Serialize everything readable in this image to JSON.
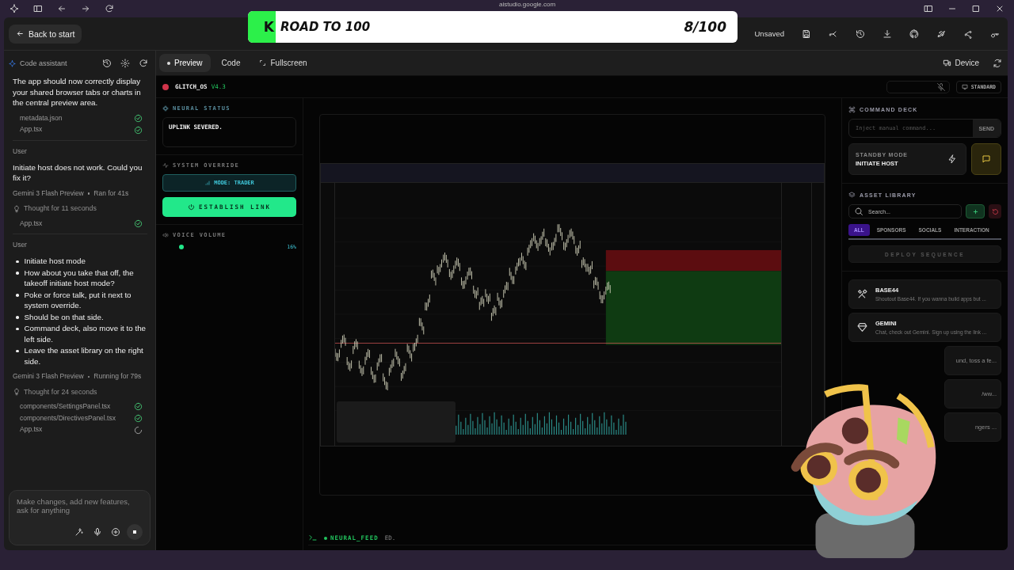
{
  "browser": {
    "url": "aistudio.google.com"
  },
  "banner": {
    "logo": "K",
    "title": "ROAD TO 100",
    "count": "8/100"
  },
  "header": {
    "back": "Back to start",
    "status": "Unsaved"
  },
  "assistant": {
    "title": "Code assistant",
    "blocks": [
      {
        "kind": "text",
        "text": "The app should now correctly display your shared browser tabs or charts in the central preview area."
      },
      {
        "kind": "files",
        "files": [
          {
            "name": "metadata.json",
            "done": true
          },
          {
            "name": "App.tsx",
            "done": true
          }
        ]
      },
      {
        "kind": "user",
        "label": "User",
        "text": "Initiate host does not work. Could you fix it?"
      },
      {
        "kind": "meta",
        "model": "Gemini 3 Flash Preview",
        "status": "Ran for 41s"
      },
      {
        "kind": "thought",
        "text": "Thought for 11 seconds"
      },
      {
        "kind": "files",
        "files": [
          {
            "name": "App.tsx",
            "done": true
          }
        ]
      },
      {
        "kind": "bullets",
        "label": "User",
        "items": [
          "Initiate host mode",
          "How about you take that off, the takeoff initiate host mode?",
          "Poke or force talk, put it next to system override.",
          "Should be on that side.",
          "Command deck, also move it to the left side.",
          "Leave the asset library on the right side."
        ]
      },
      {
        "kind": "meta",
        "model": "Gemini 3 Flash Preview",
        "status": "Running for 79s"
      },
      {
        "kind": "thought",
        "text": "Thought for 24 seconds"
      },
      {
        "kind": "files",
        "files": [
          {
            "name": "components/SettingsPanel.tsx",
            "done": true
          },
          {
            "name": "components/DirectivesPanel.tsx",
            "done": true
          },
          {
            "name": "App.tsx",
            "done": false
          }
        ]
      }
    ],
    "composer": {
      "placeholder": "Make changes, add new features, ask for anything"
    }
  },
  "tabs": [
    {
      "label": "Preview",
      "selected": true
    },
    {
      "label": "Code",
      "selected": false
    },
    {
      "label": "Fullscreen",
      "selected": false
    }
  ],
  "device": "Device",
  "app": {
    "name": "GLITCH_OS",
    "version": "V4.3",
    "view_mode": "STANDARD",
    "neural_status": {
      "label": "NEURAL STATUS",
      "text": "UPLINK SEVERED."
    },
    "override": {
      "label": "SYSTEM OVERRIDE",
      "mode": "MODE: TRADER",
      "link": "ESTABLISH LINK"
    },
    "volume": {
      "label": "VOICE VOLUME",
      "level": 0.16,
      "reading": "16%"
    },
    "feed": {
      "label": "NEURAL_FEED",
      "text": "ED."
    }
  },
  "command_deck": {
    "label": "COMMAND DECK",
    "placeholder": "Inject manual command...",
    "send": "SEND",
    "standby_label": "STANDBY MODE",
    "standby_action": "INITIATE HOST"
  },
  "asset_library": {
    "label": "ASSET LIBRARY",
    "search_placeholder": "Search...",
    "filters": [
      {
        "label": "ALL",
        "selected": true
      },
      {
        "label": "SPONSORS",
        "selected": false
      },
      {
        "label": "SOCIALS",
        "selected": false
      },
      {
        "label": "INTERACTION",
        "selected": false
      }
    ],
    "deploy": "DEPLOY SEQUENCE",
    "assets": [
      {
        "kind": "tools",
        "title": "BASE44",
        "description": "Shoutout Base44. If you wanna build apps but ..."
      },
      {
        "kind": "gem",
        "title": "GEMINI",
        "description": "Chat, check out Gemini. Sign up using the link ..."
      },
      {
        "kind": "hidden",
        "description": "und, toss a fe..."
      },
      {
        "kind": "hidden",
        "description": "/ww..."
      },
      {
        "kind": "hidden",
        "description": "ngers ..."
      }
    ]
  }
}
